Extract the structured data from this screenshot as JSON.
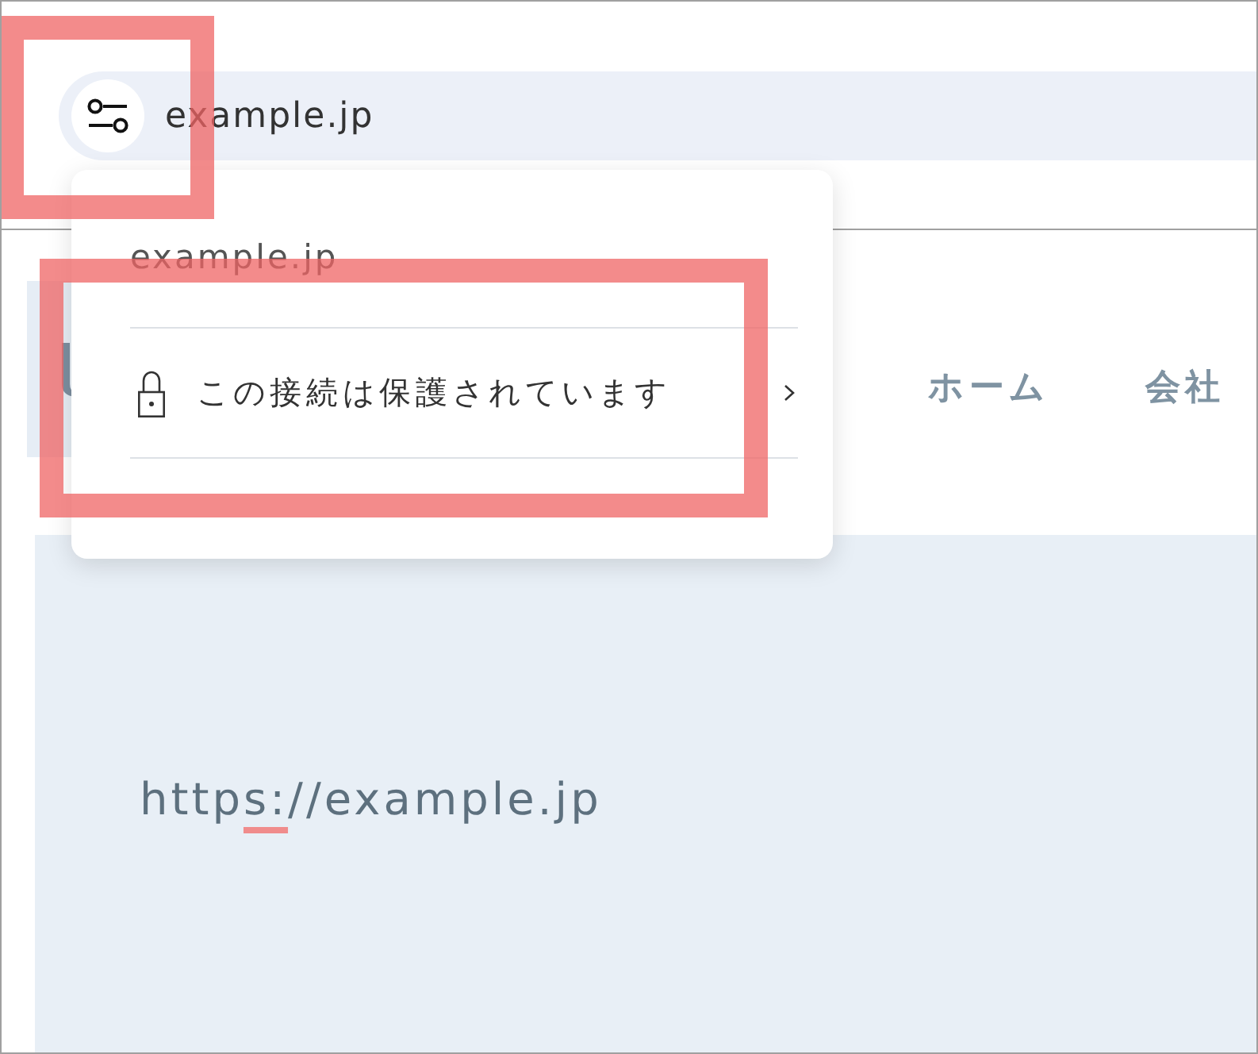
{
  "toolbar": {
    "address_bar": {
      "site_info_button": {
        "highlighted": true
      },
      "url": "example.jp"
    }
  },
  "site_info_popup": {
    "domain": "example.jp",
    "rows": [
      {
        "kind": "connection",
        "label": "この接続は保護されています",
        "highlighted": true
      }
    ]
  },
  "page": {
    "nav": [
      {
        "label": "ホーム"
      },
      {
        "label": "会社"
      }
    ],
    "hero": {
      "url_parts": [
        {
          "text": "http",
          "highlighted": false
        },
        {
          "text": "s:",
          "highlighted": true
        },
        {
          "text": "//example.jp",
          "highlighted": false
        }
      ]
    }
  }
}
